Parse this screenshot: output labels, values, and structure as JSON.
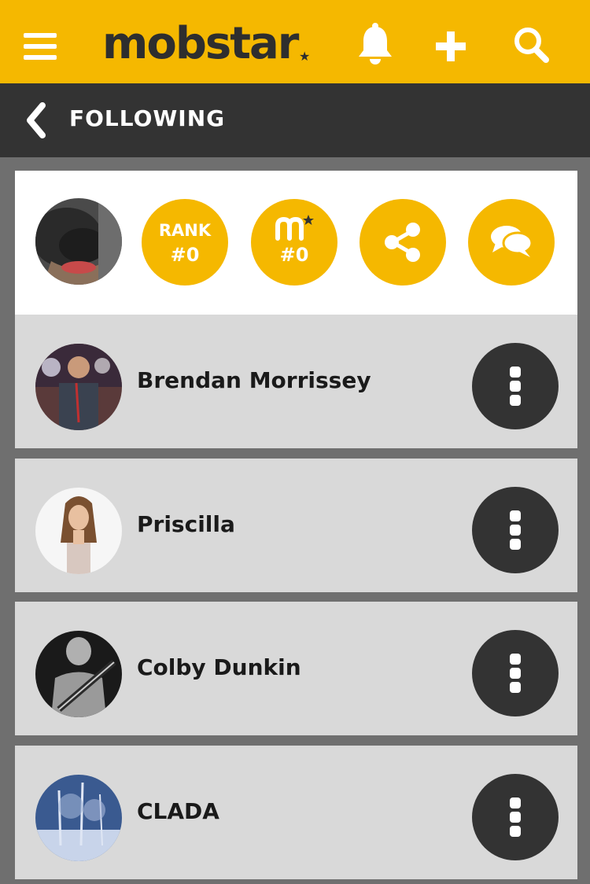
{
  "topbar": {
    "logo_text": "mobstar",
    "menu_icon": "hamburger-menu-icon",
    "bell_icon": "bell-icon",
    "add_icon": "plus-icon",
    "search_icon": "search-icon"
  },
  "subbar": {
    "title": "FOLLOWING",
    "back_icon": "chevron-left-icon"
  },
  "profile": {
    "rank_label": "RANK",
    "rank_value": "#0",
    "mobstar_value": "#0",
    "share_icon": "share-icon",
    "chat_icon": "chat-bubbles-icon"
  },
  "following": [
    {
      "name": "Brendan Morrissey"
    },
    {
      "name": "Priscilla"
    },
    {
      "name": "Colby Dunkin"
    },
    {
      "name": "CLADA"
    }
  ],
  "colors": {
    "accent": "#f5b800",
    "dark": "#333333",
    "row_bg": "#d9d9d9",
    "page_bg": "#6f6f6f"
  }
}
